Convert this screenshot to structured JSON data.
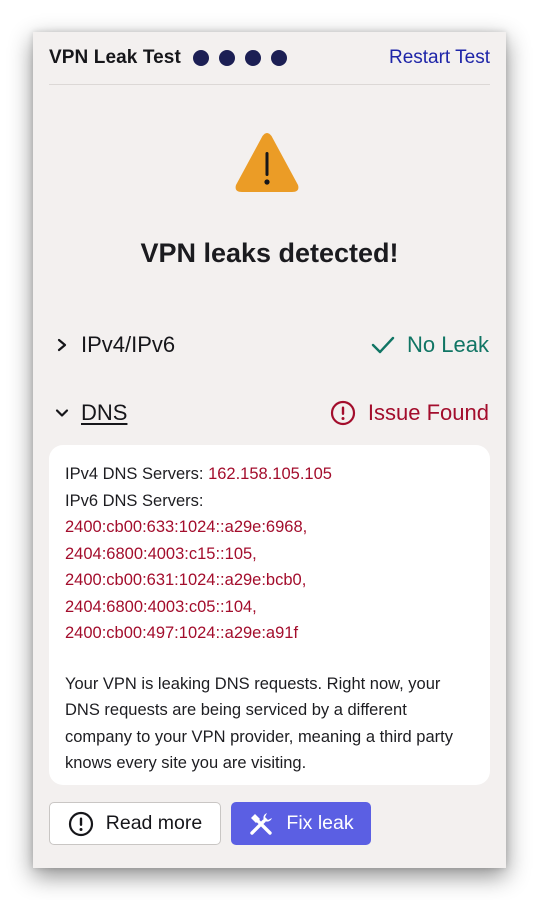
{
  "header": {
    "title": "VPN Leak Test",
    "progress_dots": 4,
    "restart_label": "Restart Test"
  },
  "result": {
    "icon": "warning-triangle-icon",
    "headline": "VPN leaks detected!"
  },
  "tests": [
    {
      "label": "IPv4/IPv6",
      "expanded": false,
      "status": "No Leak",
      "status_icon": "checkmark-icon",
      "status_color": "#107564"
    },
    {
      "label": "DNS",
      "expanded": true,
      "status": "Issue Found",
      "status_icon": "exclamation-circle-icon",
      "status_color": "#a30d2c"
    }
  ],
  "dns_details": {
    "ipv4_label": "IPv4 DNS Servers:",
    "ipv4_value": "162.158.105.105",
    "ipv6_label": "IPv6 DNS Servers:",
    "ipv6_values": [
      "2400:cb00:633:1024::a29e:6968,",
      "2404:6800:4003:c15::105,",
      "2400:cb00:631:1024::a29e:bcb0,",
      "2404:6800:4003:c05::104,",
      "2400:cb00:497:1024::a29e:a91f"
    ],
    "description": "Your VPN is leaking DNS requests. Right now, your DNS requests are being serviced by a different company to your VPN provider, meaning a third party knows every site you are visiting."
  },
  "actions": {
    "read_more_label": "Read more",
    "fix_leak_label": "Fix leak"
  },
  "colors": {
    "accent": "#5b5fe3",
    "danger": "#a30d2c",
    "success": "#107564",
    "warning": "#eb9c26",
    "link": "#1e25a8"
  }
}
